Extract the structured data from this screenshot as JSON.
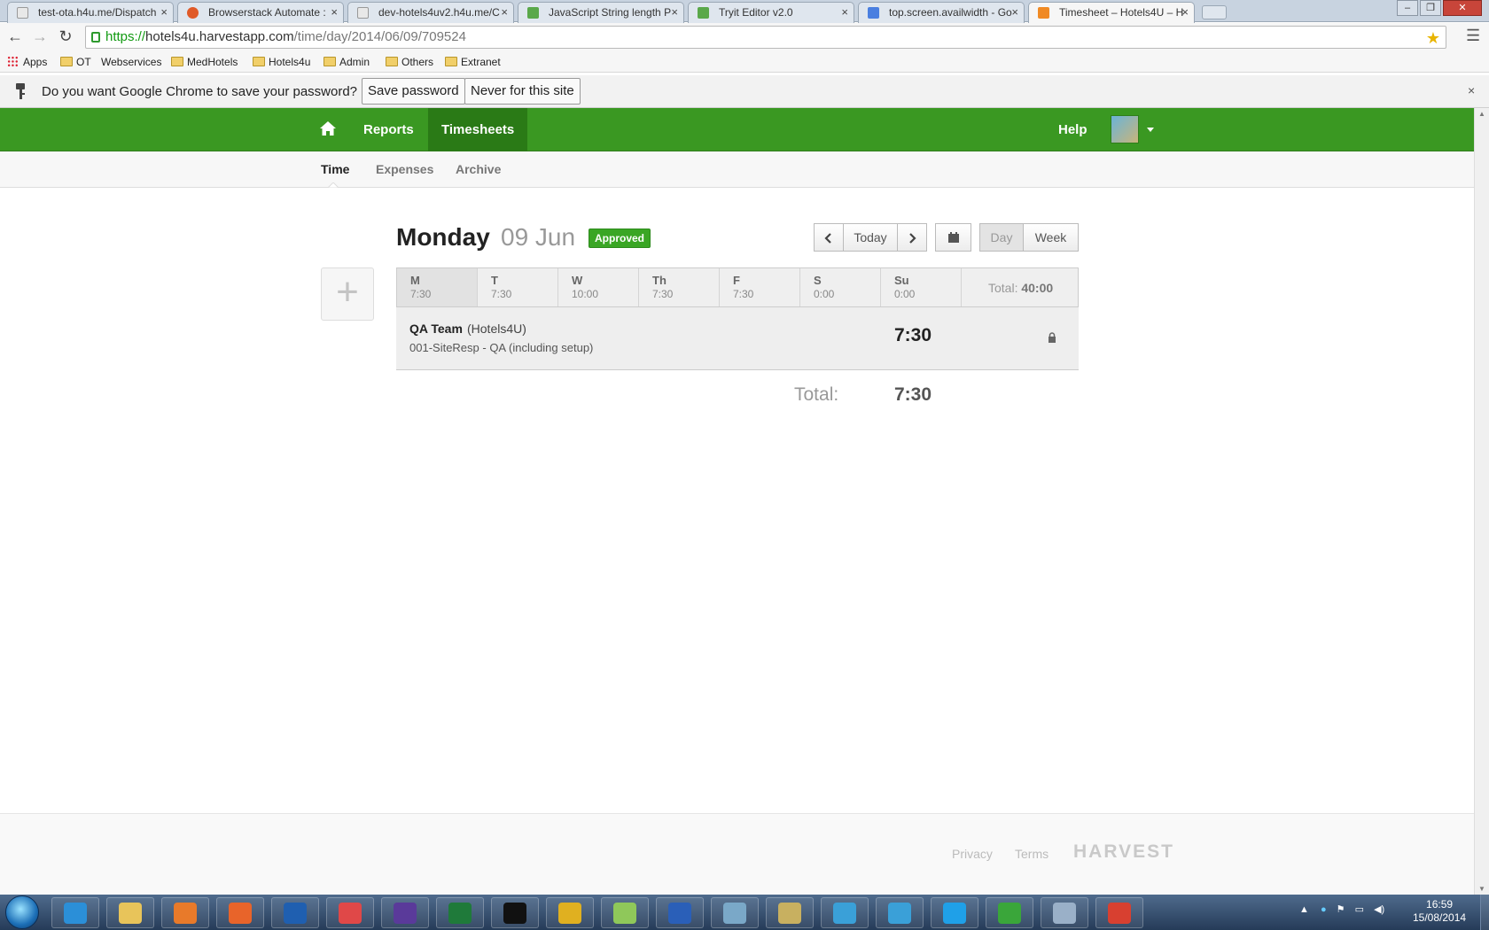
{
  "browser": {
    "tabs": [
      {
        "title": "test-ota.h4u.me/Dispatch",
        "favicon_color": "#e8e8e8"
      },
      {
        "title": "Browserstack Automate :",
        "favicon_color": "#e05a28"
      },
      {
        "title": "dev-hotels4uv2.h4u.me/C",
        "favicon_color": "#e8e8e8"
      },
      {
        "title": "JavaScript String length P",
        "favicon_color": "#5aa84a"
      },
      {
        "title": "Tryit Editor v2.0",
        "favicon_color": "#5aa84a"
      },
      {
        "title": "top.screen.availwidth - Go",
        "favicon_color": "#4a7fe0"
      },
      {
        "title": "Timesheet – Hotels4U – H",
        "favicon_color": "#f08a24"
      }
    ],
    "url": {
      "scheme": "https://",
      "host": "hotels4u.harvestapp.com",
      "path": "/time/day/2014/06/09/709524"
    },
    "bookmarks": [
      "Apps",
      "OT",
      "Webservices",
      "MedHotels",
      "Hotels4u",
      "Admin",
      "Others",
      "Extranet"
    ],
    "infobar": {
      "question": "Do you want Google Chrome to save your password?",
      "save_label": "Save password",
      "never_label": "Never for this site"
    }
  },
  "header": {
    "nav": [
      "Reports",
      "Timesheets"
    ],
    "active_nav": "Timesheets",
    "help_label": "Help",
    "brand_color": "#3a9822"
  },
  "subnav": {
    "items": [
      "Time",
      "Expenses",
      "Archive"
    ],
    "active": "Time"
  },
  "timesheet": {
    "day_name": "Monday",
    "date": "09 Jun",
    "status_badge": "Approved",
    "controls": {
      "today_label": "Today",
      "day_label": "Day",
      "week_label": "Week"
    },
    "week": [
      {
        "day": "M",
        "hours": "7:30"
      },
      {
        "day": "T",
        "hours": "7:30"
      },
      {
        "day": "W",
        "hours": "10:00"
      },
      {
        "day": "Th",
        "hours": "7:30"
      },
      {
        "day": "F",
        "hours": "7:30"
      },
      {
        "day": "S",
        "hours": "0:00"
      },
      {
        "day": "Su",
        "hours": "0:00"
      }
    ],
    "week_total_label": "Total:",
    "week_total": "40:00",
    "entries": [
      {
        "project": "QA Team",
        "client": "(Hotels4U)",
        "task": "001-SiteResp - QA (including setup)",
        "hours": "7:30"
      }
    ],
    "day_total_label": "Total:",
    "day_total": "7:30"
  },
  "footer": {
    "privacy_label": "Privacy",
    "terms_label": "Terms",
    "brand": "HARVEST"
  },
  "taskbar": {
    "time": "16:59",
    "date": "15/08/2014",
    "apps": [
      {
        "name": "internet-explorer-icon",
        "color": "#2b8fd8"
      },
      {
        "name": "file-explorer-icon",
        "color": "#e8c45a"
      },
      {
        "name": "media-player-icon",
        "color": "#e87a2a"
      },
      {
        "name": "firefox-icon",
        "color": "#e8642a"
      },
      {
        "name": "outlook-icon",
        "color": "#1f5fb0"
      },
      {
        "name": "snipping-tool-icon",
        "color": "#e04848"
      },
      {
        "name": "eclipse-icon",
        "color": "#5a3a9a"
      },
      {
        "name": "excel-icon",
        "color": "#1f7a3a"
      },
      {
        "name": "command-prompt-icon",
        "color": "#111111"
      },
      {
        "name": "chrome-icon",
        "color": "#e0b020"
      },
      {
        "name": "notepad-plus-icon",
        "color": "#8fc85a"
      },
      {
        "name": "word-icon",
        "color": "#2a5fb8"
      },
      {
        "name": "editor-icon",
        "color": "#7aa8c8"
      },
      {
        "name": "tools-icon",
        "color": "#c8b060"
      },
      {
        "name": "webstorm-icon",
        "color": "#3aa0d8"
      },
      {
        "name": "webstorm-icon",
        "color": "#3aa0d8"
      },
      {
        "name": "skype-icon",
        "color": "#1fa0e8"
      },
      {
        "name": "sync-icon",
        "color": "#3aa63a"
      },
      {
        "name": "calculator-icon",
        "color": "#9ab0c8"
      },
      {
        "name": "headphones-icon",
        "color": "#d84030"
      }
    ]
  }
}
